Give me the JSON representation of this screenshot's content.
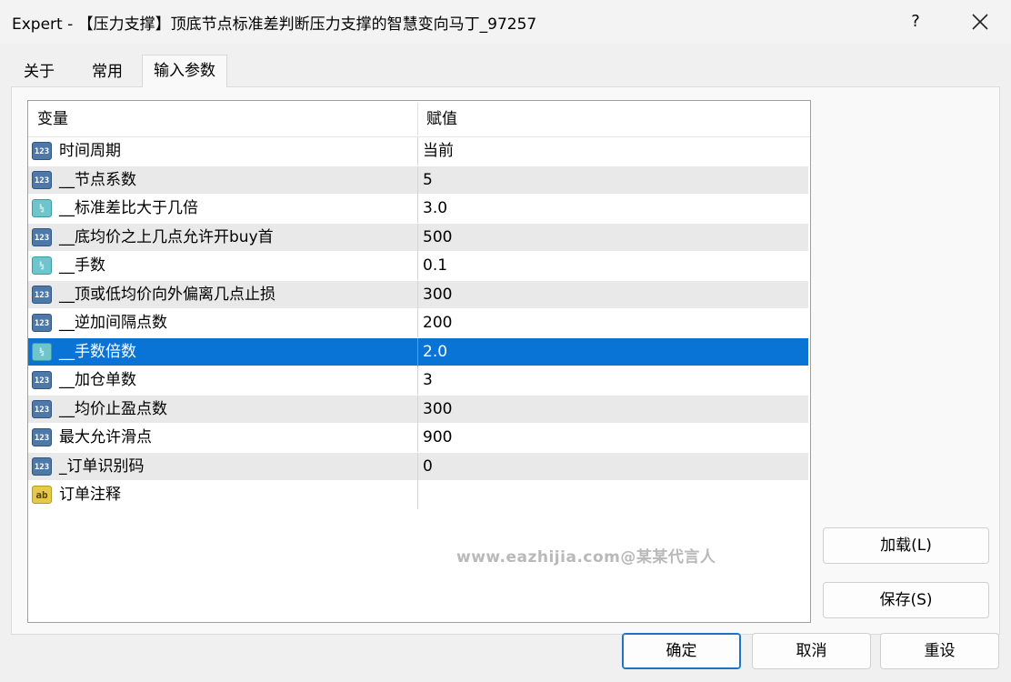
{
  "window": {
    "title": "Expert - 【压力支撑】顶底节点标准差判断压力支撑的智慧变向马丁_97257",
    "help_label": "?",
    "close_icon": "close-icon"
  },
  "tabs": [
    {
      "label": "关于",
      "active": false
    },
    {
      "label": "常用",
      "active": false
    },
    {
      "label": "输入参数",
      "active": true
    }
  ],
  "grid": {
    "columns": [
      "变量",
      "赋值"
    ],
    "rows": [
      {
        "type": "int",
        "icon_text": "123",
        "name": "时间周期",
        "value": "当前"
      },
      {
        "type": "int",
        "icon_text": "123",
        "name": "__节点系数",
        "value": "5"
      },
      {
        "type": "double",
        "icon_text": "½",
        "name": "__标准差比大于几倍",
        "value": "3.0"
      },
      {
        "type": "int",
        "icon_text": "123",
        "name": "__底均价之上几点允许开buy首",
        "value": "500"
      },
      {
        "type": "double",
        "icon_text": "½",
        "name": "__手数",
        "value": "0.1"
      },
      {
        "type": "int",
        "icon_text": "123",
        "name": "__顶或低均价向外偏离几点止损",
        "value": "300"
      },
      {
        "type": "int",
        "icon_text": "123",
        "name": "__逆加间隔点数",
        "value": "200"
      },
      {
        "type": "double",
        "icon_text": "½",
        "name": "__手数倍数",
        "value": "2.0",
        "selected": true
      },
      {
        "type": "int",
        "icon_text": "123",
        "name": "__加仓单数",
        "value": "3"
      },
      {
        "type": "int",
        "icon_text": "123",
        "name": "__均价止盈点数",
        "value": "300"
      },
      {
        "type": "int",
        "icon_text": "123",
        "name": "最大允许滑点",
        "value": "900"
      },
      {
        "type": "int",
        "icon_text": "123",
        "name": "_订单识别码",
        "value": "0"
      },
      {
        "type": "string",
        "icon_text": "ab",
        "name": "订单注释",
        "value": ""
      }
    ]
  },
  "watermark": "www.eazhijia.com@某某代言人",
  "side_buttons": {
    "load": "加载(L)",
    "save": "保存(S)"
  },
  "footer_buttons": {
    "ok": "确定",
    "cancel": "取消",
    "reset": "重设"
  },
  "colors": {
    "selection": "#0a74d6",
    "alt_row": "#e9e9e9"
  }
}
